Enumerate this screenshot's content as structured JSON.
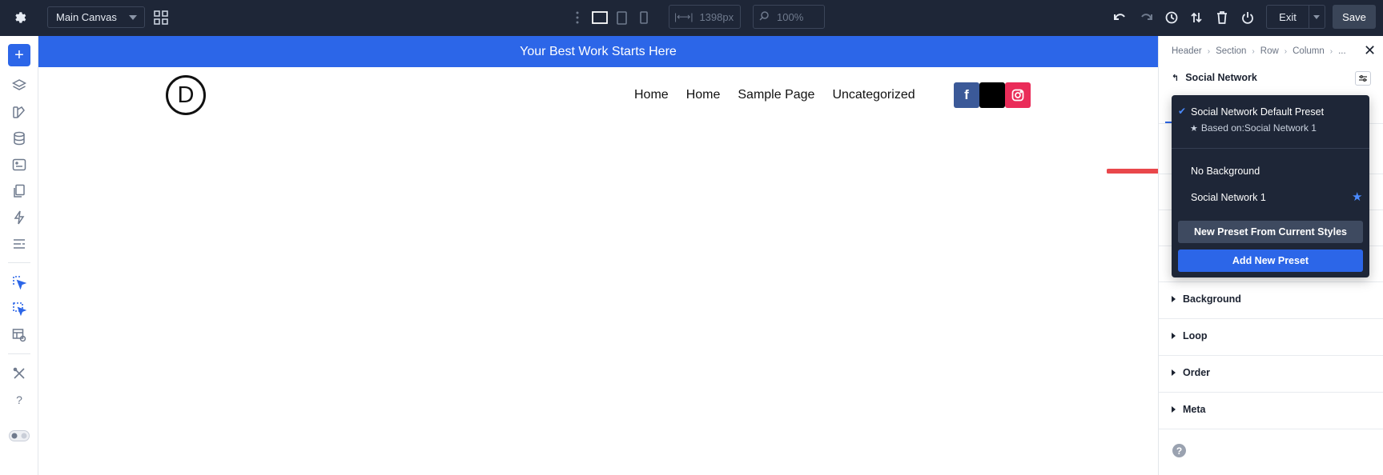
{
  "topbar": {
    "canvas_select": "Main Canvas",
    "width_value": "1398px",
    "zoom_value": "100%",
    "exit_label": "Exit",
    "save_label": "Save"
  },
  "canvas": {
    "banner_text": "Your Best Work Starts Here",
    "logo_letter": "D",
    "nav": [
      "Home",
      "Home",
      "Sample Page",
      "Uncategorized"
    ],
    "social": [
      {
        "icon": "facebook-icon",
        "glyph": "f",
        "color": "#3b5998"
      },
      {
        "icon": "x-icon",
        "glyph": "",
        "color": "#000000"
      },
      {
        "icon": "instagram-icon",
        "glyph": "◎",
        "color": "#ea2c59"
      }
    ]
  },
  "panel": {
    "breadcrumb": [
      "Header",
      "Section",
      "Row",
      "Column",
      "..."
    ],
    "module_title": "Social Network",
    "accordion": [
      "Background",
      "Loop",
      "Order",
      "Meta"
    ],
    "help": "?"
  },
  "dropdown": {
    "active_preset": "Social Network Default Preset",
    "based_on": "Based on:Social Network 1",
    "items": [
      "No Background",
      "Social Network 1"
    ],
    "new_from_styles": "New Preset From Current Styles",
    "add_new": "Add New Preset"
  },
  "colors": {
    "accent": "#2c66e8",
    "topbar": "#1e2637",
    "arrow": "#e9474b"
  }
}
